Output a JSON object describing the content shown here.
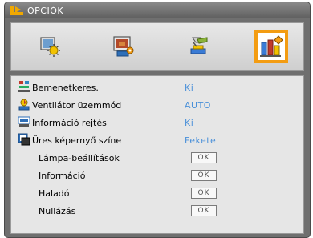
{
  "header": {
    "title": "OPCIÓK"
  },
  "tabs": [
    {
      "name": "image-settings-icon",
      "selected": false
    },
    {
      "name": "display-settings-icon",
      "selected": false
    },
    {
      "name": "setup-icon",
      "selected": false
    },
    {
      "name": "options-icon",
      "selected": true
    }
  ],
  "menu": {
    "items": [
      {
        "label": "Bemenetkeres.",
        "value": "Ki",
        "icon": "input-search-icon"
      },
      {
        "label": "Ventilátor üzemmód",
        "value": "AUTO",
        "icon": "fan-mode-icon"
      },
      {
        "label": "Információ rejtés",
        "value": "Ki",
        "icon": "info-hide-icon"
      },
      {
        "label": "Üres képernyő színe",
        "value": "Fekete",
        "icon": "blank-screen-color-icon"
      },
      {
        "label": "Lámpa-beállítások",
        "button": "OK"
      },
      {
        "label": "Információ",
        "button": "OK"
      },
      {
        "label": "Haladó",
        "button": "OK"
      },
      {
        "label": "Nullázás",
        "button": "OK"
      }
    ]
  },
  "colors": {
    "accent": "#f39c12",
    "value_text": "#4a90d9"
  }
}
